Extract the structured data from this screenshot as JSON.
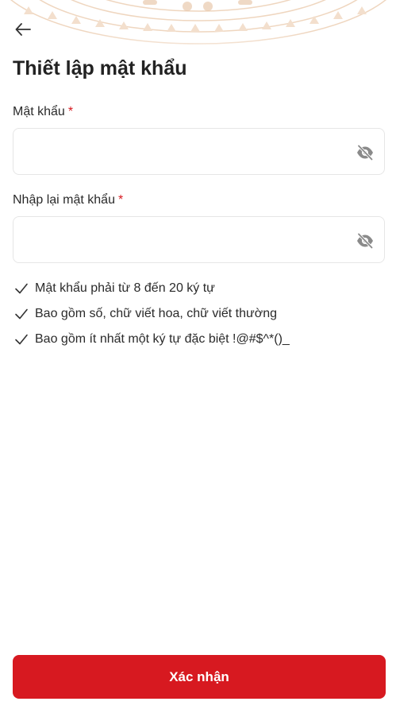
{
  "header": {
    "title": "Thiết lập mật khẩu",
    "back_icon": "arrow-left-icon"
  },
  "form": {
    "password": {
      "label": "Mật khẩu",
      "required_mark": "*",
      "value": "",
      "toggle_icon": "eye-off-icon"
    },
    "confirm_password": {
      "label": "Nhập lại mật khẩu",
      "required_mark": "*",
      "value": "",
      "toggle_icon": "eye-off-icon"
    }
  },
  "rules": [
    {
      "icon": "check-icon",
      "text": "Mật khẩu phải từ 8 đến 20 ký tự"
    },
    {
      "icon": "check-icon",
      "text": "Bao gồm số, chữ viết hoa, chữ viết thường"
    },
    {
      "icon": "check-icon",
      "text": "Bao gồm ít nhất một ký tự đặc biệt !@#$^*()_"
    }
  ],
  "actions": {
    "submit_label": "Xác nhận"
  },
  "colors": {
    "accent": "#d71920",
    "text": "#222222",
    "border": "#e6e6e6",
    "decor": "#f0d9c4"
  }
}
